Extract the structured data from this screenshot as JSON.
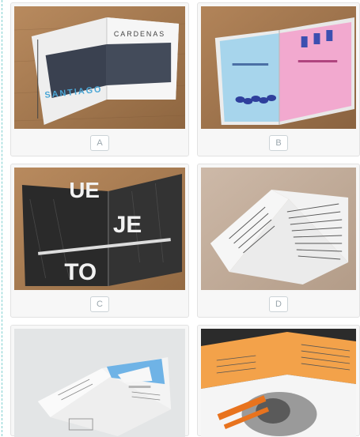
{
  "options": [
    {
      "label": "A",
      "image": "magazine-santiago-spread",
      "headline_left": "SANTIAGO",
      "headline_top": "CARDENAS"
    },
    {
      "label": "B",
      "image": "magazine-blue-pink-spread"
    },
    {
      "label": "C",
      "image": "magazine-black-white-typography",
      "big_letters": "UE JE TO"
    },
    {
      "label": "D",
      "image": "magazine-text-heavy-spread"
    },
    {
      "label": "",
      "image": "brochure-villa-pool-spread"
    },
    {
      "label": "",
      "image": "magazine-orange-portrait-spread"
    }
  ]
}
